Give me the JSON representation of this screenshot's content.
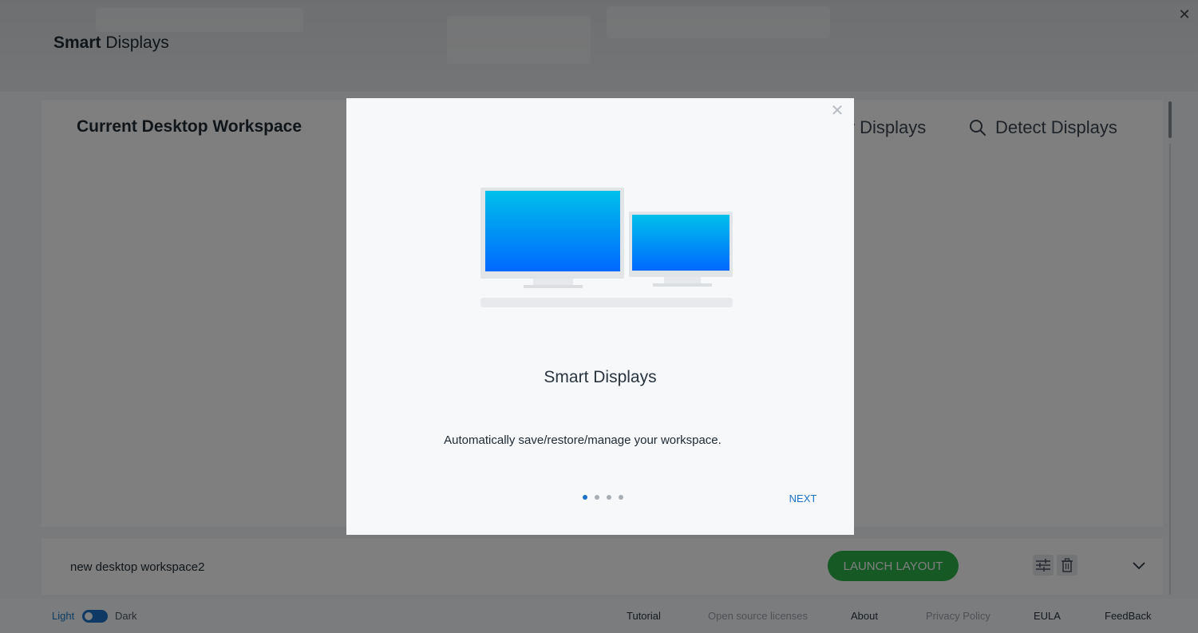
{
  "header": {
    "title_bold": "Smart",
    "title_rest": " Displays",
    "close_glyph": "✕"
  },
  "workspace": {
    "title": "Current Desktop Workspace",
    "displays_label": "y Displays",
    "detect_label": "Detect Displays",
    "row_name": "new desktop workspace2",
    "launch_label": "LAUNCH LAYOUT",
    "accent_color": "#2db34a"
  },
  "footer": {
    "light": "Light",
    "dark": "Dark",
    "links": [
      "Tutorial",
      "Open source licenses",
      "About",
      "Privacy Policy",
      "EULA",
      "FeedBack"
    ]
  },
  "modal": {
    "close_glyph": "✕",
    "title": "Smart Displays",
    "description": "Automatically save/restore/manage your workspace.",
    "next_label": "NEXT",
    "page_index": 1,
    "page_count": 4,
    "accent_color": "#1a73c8"
  },
  "icons": [
    "search-icon",
    "settings-sliders-icon",
    "trash-icon",
    "chevron-down-icon",
    "close-icon",
    "monitor-illustration"
  ]
}
